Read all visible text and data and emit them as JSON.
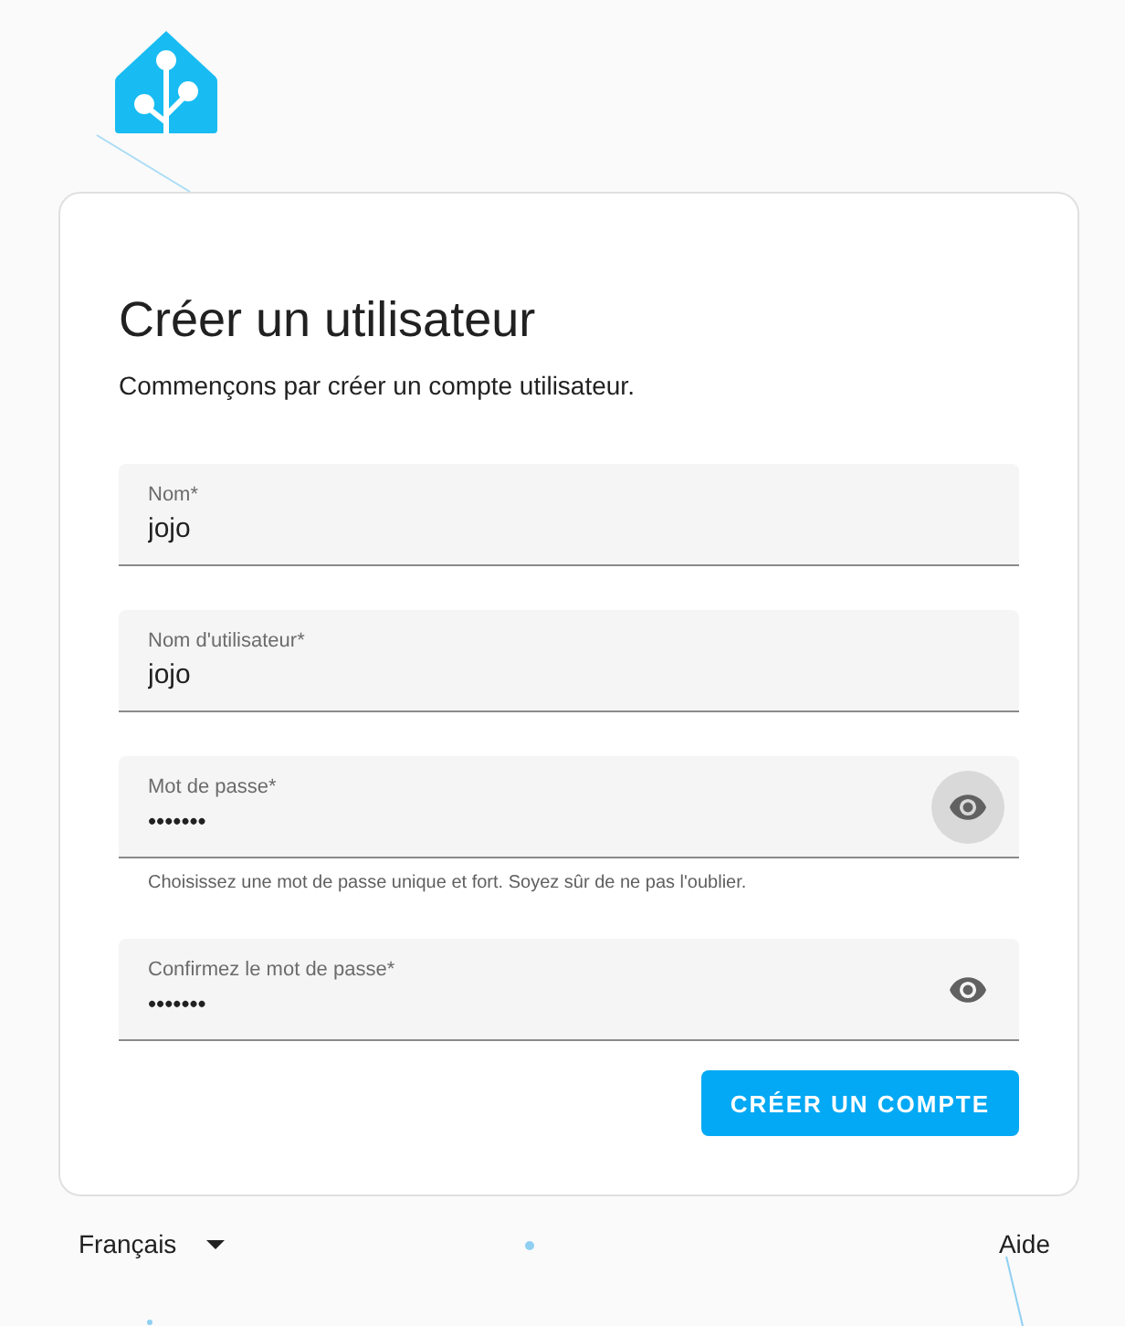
{
  "card": {
    "title": "Créer un utilisateur",
    "subtitle": "Commençons par créer un compte utilisateur."
  },
  "fields": [
    {
      "kind": "text",
      "label": "Nom*",
      "value": "jojo"
    },
    {
      "kind": "text",
      "label": "Nom d'utilisateur*",
      "value": "jojo"
    },
    {
      "kind": "password",
      "label": "Mot de passe*",
      "value": "•••••••",
      "eye_highlighted": true,
      "helper": "Choisissez une mot de passe unique et fort. Soyez sûr de ne pas l'oublier."
    },
    {
      "kind": "password",
      "label": "Confirmez le mot de passe*",
      "value": "•••••••",
      "eye_highlighted": false
    }
  ],
  "submit": "CRÉER UN COMPTE",
  "footer": {
    "language": "Français",
    "help": "Aide"
  }
}
